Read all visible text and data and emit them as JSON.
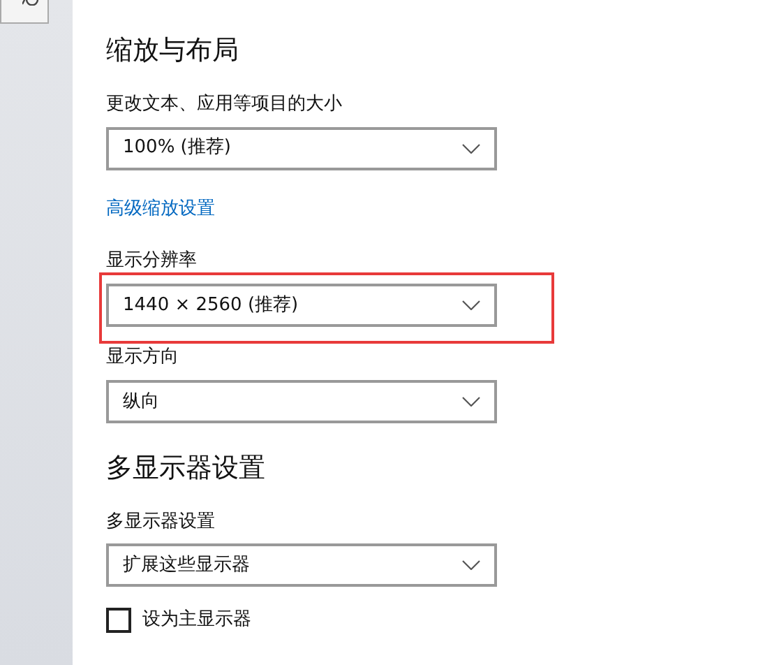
{
  "sections": [
    {
      "heading": "缩放与布局",
      "items": [
        {
          "kind": "label",
          "text": "更改文本、应用等项目的大小"
        },
        {
          "kind": "dropdown",
          "value": "100% (推荐)",
          "highlighted": false
        },
        {
          "kind": "link",
          "text": "高级缩放设置"
        },
        {
          "kind": "label",
          "text": "显示分辨率"
        },
        {
          "kind": "dropdown",
          "value": "1440 × 2560 (推荐)",
          "highlighted": true
        },
        {
          "kind": "label",
          "text": "显示方向"
        },
        {
          "kind": "dropdown",
          "value": "纵向",
          "highlighted": false
        }
      ]
    },
    {
      "heading": "多显示器设置",
      "items": [
        {
          "kind": "label",
          "text": "多显示器设置"
        },
        {
          "kind": "dropdown",
          "value": "扩展这些显示器",
          "highlighted": false
        },
        {
          "kind": "checkbox",
          "text": "设为主显示器",
          "checked": false
        }
      ]
    }
  ]
}
